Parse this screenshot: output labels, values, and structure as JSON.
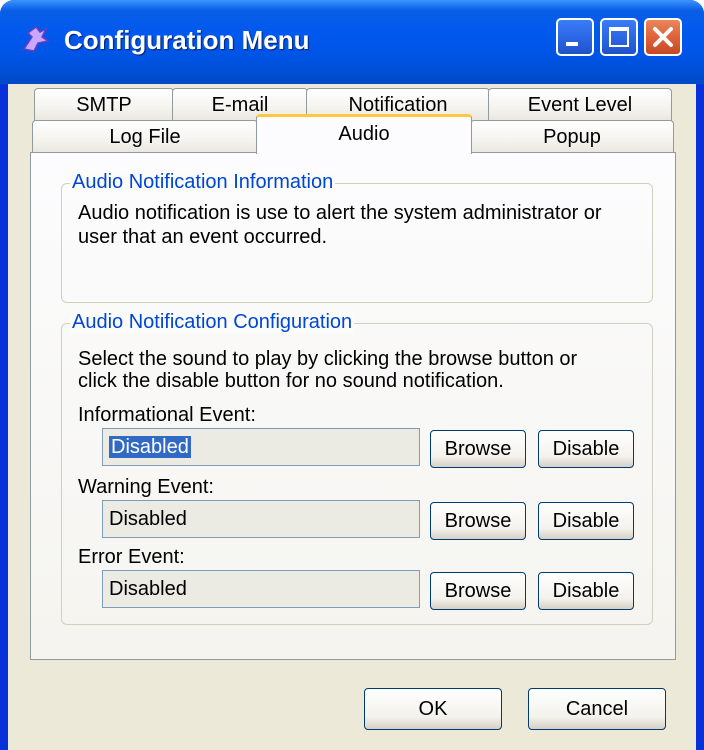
{
  "window": {
    "title": "Configuration Menu"
  },
  "tabs_row1": [
    "SMTP",
    "E-mail",
    "Notification",
    "Event Level"
  ],
  "tabs_row2": [
    "Log File",
    "Audio",
    "Popup"
  ],
  "active_tab": "Audio",
  "info_group": {
    "title": "Audio Notification Information",
    "line1": "Audio notification is use to alert the system administrator or",
    "line2": "user that an event occurred."
  },
  "config_group": {
    "title": "Audio Notification Configuration",
    "line1": "Select the sound to play by clicking the browse button or",
    "line2": "click the disable button for no sound notification.",
    "events": [
      {
        "label": "Informational Event:",
        "value": "Disabled",
        "selected": true
      },
      {
        "label": "Warning Event:",
        "value": "Disabled",
        "selected": false
      },
      {
        "label": "Error Event:",
        "value": "Disabled",
        "selected": false
      }
    ],
    "browse_label": "Browse",
    "disable_label": "Disable"
  },
  "footer": {
    "ok_label": "OK",
    "cancel_label": "Cancel"
  },
  "colors": {
    "titlebar": "#0054e3",
    "client": "#ece9d8",
    "group_title": "#0046d5",
    "selection": "#316ac5"
  }
}
